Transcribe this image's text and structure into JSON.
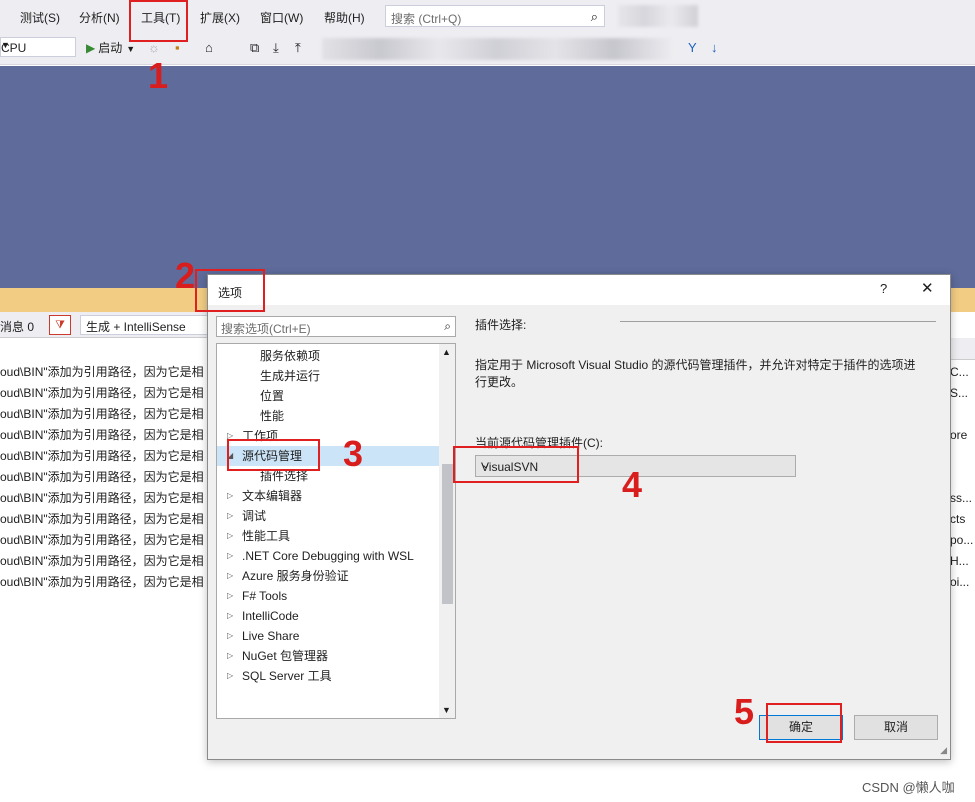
{
  "menu": {
    "items": [
      "测试(S)",
      "分析(N)",
      "工具(T)",
      "扩展(X)",
      "窗口(W)",
      "帮助(H)"
    ],
    "search_placeholder": "搜索 (Ctrl+Q)"
  },
  "toolbar": {
    "platform": "CPU",
    "start_label": "启动"
  },
  "error_list": {
    "messages_label": "消息 0",
    "build_filter": "生成 + IntelliSense",
    "rows": [
      "oud\\BIN\"添加为引用路径，因为它是相",
      "oud\\BIN\"添加为引用路径，因为它是相",
      "oud\\BIN\"添加为引用路径，因为它是相",
      "oud\\BIN\"添加为引用路径，因为它是相",
      "oud\\BIN\"添加为引用路径，因为它是相",
      "oud\\BIN\"添加为引用路径，因为它是相",
      "oud\\BIN\"添加为引用路径，因为它是相",
      "oud\\BIN\"添加为引用路径，因为它是相",
      "oud\\BIN\"添加为引用路径，因为它是相",
      "oud\\BIN\"添加为引用路径，因为它是相",
      "oud\\BIN\"添加为引用路径，因为它是相"
    ],
    "right_fragments": [
      "C...",
      "S...",
      "",
      "ore",
      "",
      "ss...",
      "cts",
      "po...",
      "H...",
      "oi...",
      ""
    ]
  },
  "dialog": {
    "title": "选项",
    "help": "?",
    "close": "✕",
    "search_placeholder": "搜索选项(Ctrl+E)",
    "tree": [
      {
        "label": "服务依赖项",
        "indent": 2,
        "arrow": ""
      },
      {
        "label": "生成并运行",
        "indent": 2,
        "arrow": ""
      },
      {
        "label": "位置",
        "indent": 2,
        "arrow": ""
      },
      {
        "label": "性能",
        "indent": 2,
        "arrow": ""
      },
      {
        "label": "工作项",
        "indent": 1,
        "arrow": "▷"
      },
      {
        "label": "源代码管理",
        "indent": 1,
        "arrow": "◢",
        "selected": true
      },
      {
        "label": "插件选择",
        "indent": 2,
        "arrow": ""
      },
      {
        "label": "文本编辑器",
        "indent": 1,
        "arrow": "▷"
      },
      {
        "label": "调试",
        "indent": 1,
        "arrow": "▷"
      },
      {
        "label": "性能工具",
        "indent": 1,
        "arrow": "▷"
      },
      {
        "label": ".NET Core Debugging with WSL",
        "indent": 1,
        "arrow": "▷"
      },
      {
        "label": "Azure 服务身份验证",
        "indent": 1,
        "arrow": "▷"
      },
      {
        "label": "F# Tools",
        "indent": 1,
        "arrow": "▷"
      },
      {
        "label": "IntelliCode",
        "indent": 1,
        "arrow": "▷"
      },
      {
        "label": "Live Share",
        "indent": 1,
        "arrow": "▷"
      },
      {
        "label": "NuGet 包管理器",
        "indent": 1,
        "arrow": "▷"
      },
      {
        "label": "SQL Server 工具",
        "indent": 1,
        "arrow": "▷"
      }
    ],
    "section_title": "插件选择:",
    "description": "指定用于 Microsoft Visual Studio 的源代码管理插件，并允许对特定于插件的选项进行更改。",
    "current_label": "当前源代码管理插件(C):",
    "current_value": "VisualSVN",
    "ok": "确定",
    "cancel": "取消"
  },
  "annotations": [
    "1",
    "2",
    "3",
    "4",
    "5"
  ],
  "watermark": "CSDN @懒人咖",
  "colors": {
    "editor": "#5e6b9b",
    "gold": "#f2cc83",
    "annotation": "#e02020",
    "selection": "#cce4f7"
  }
}
